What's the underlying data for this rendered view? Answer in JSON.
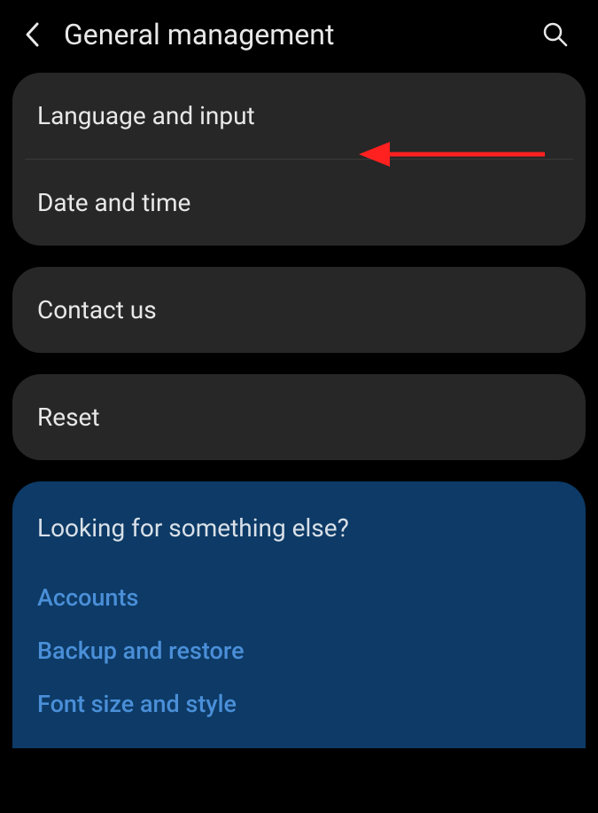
{
  "header": {
    "title": "General management"
  },
  "group1": {
    "items": [
      {
        "label": "Language and input"
      },
      {
        "label": "Date and time"
      }
    ]
  },
  "group2": {
    "items": [
      {
        "label": "Contact us"
      }
    ]
  },
  "group3": {
    "items": [
      {
        "label": "Reset"
      }
    ]
  },
  "suggestions": {
    "title": "Looking for something else?",
    "links": [
      {
        "label": "Accounts"
      },
      {
        "label": "Backup and restore"
      },
      {
        "label": "Font size and style"
      }
    ]
  }
}
